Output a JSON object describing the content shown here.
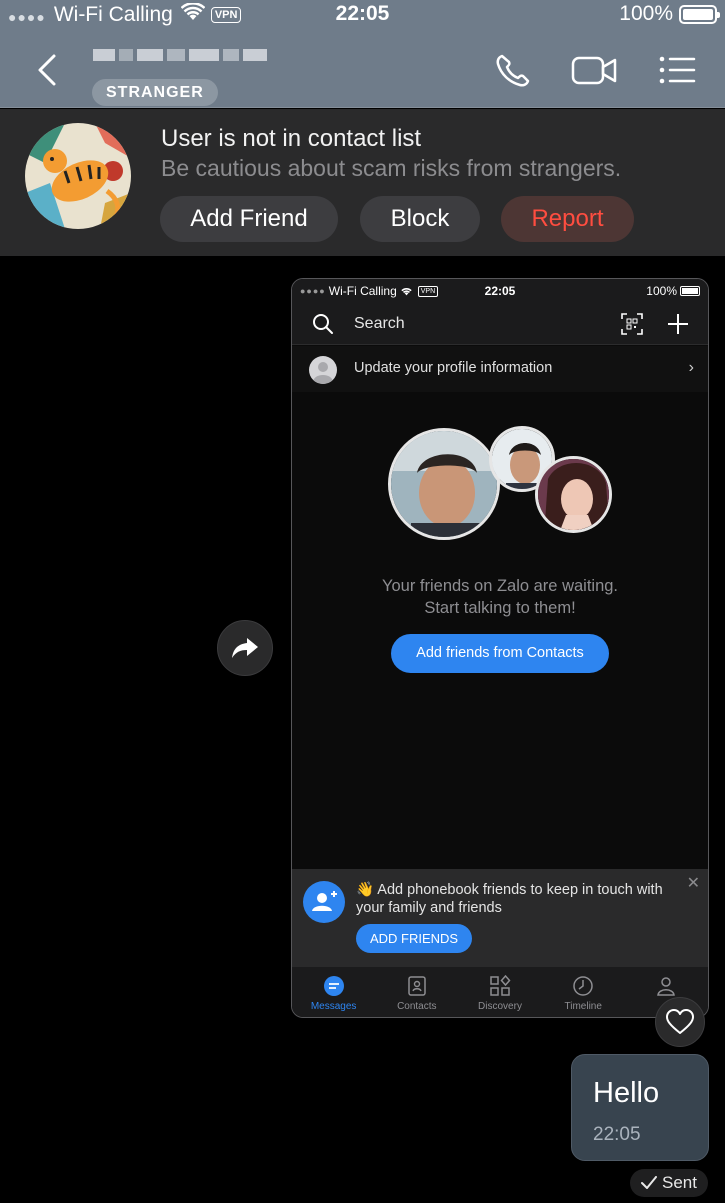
{
  "status_bar": {
    "carrier": "Wi-Fi Calling",
    "vpn": "VPN",
    "time": "22:05",
    "battery": "100%"
  },
  "header": {
    "contact_name": "",
    "badge": "STRANGER",
    "icons": [
      "back-icon",
      "phone-icon",
      "video-icon",
      "menu-list-icon"
    ]
  },
  "stranger_notice": {
    "title": "User is not in contact list",
    "subtitle": "Be cautious about scam risks from strangers.",
    "add_friend": "Add Friend",
    "block": "Block",
    "report": "Report",
    "report_color": "#ff4d40"
  },
  "shared_screenshot": {
    "status": {
      "carrier": "Wi-Fi Calling",
      "vpn": "VPN",
      "time": "22:05",
      "battery": "100%"
    },
    "search_placeholder": "Search",
    "update_profile": "Update your profile information",
    "waiting_line1": "Your friends on Zalo are waiting.",
    "waiting_line2": "Start talking to them!",
    "cta": "Add friends from Contacts",
    "banner_text": "👋 Add phonebook friends to keep in touch with your family and friends",
    "banner_button": "ADD FRIENDS",
    "tabs": [
      "Messages",
      "Contacts",
      "Discovery",
      "Timeline",
      ""
    ],
    "accent": "#2e85f0"
  },
  "message": {
    "text": "Hello",
    "time": "22:05",
    "status": "Sent"
  }
}
